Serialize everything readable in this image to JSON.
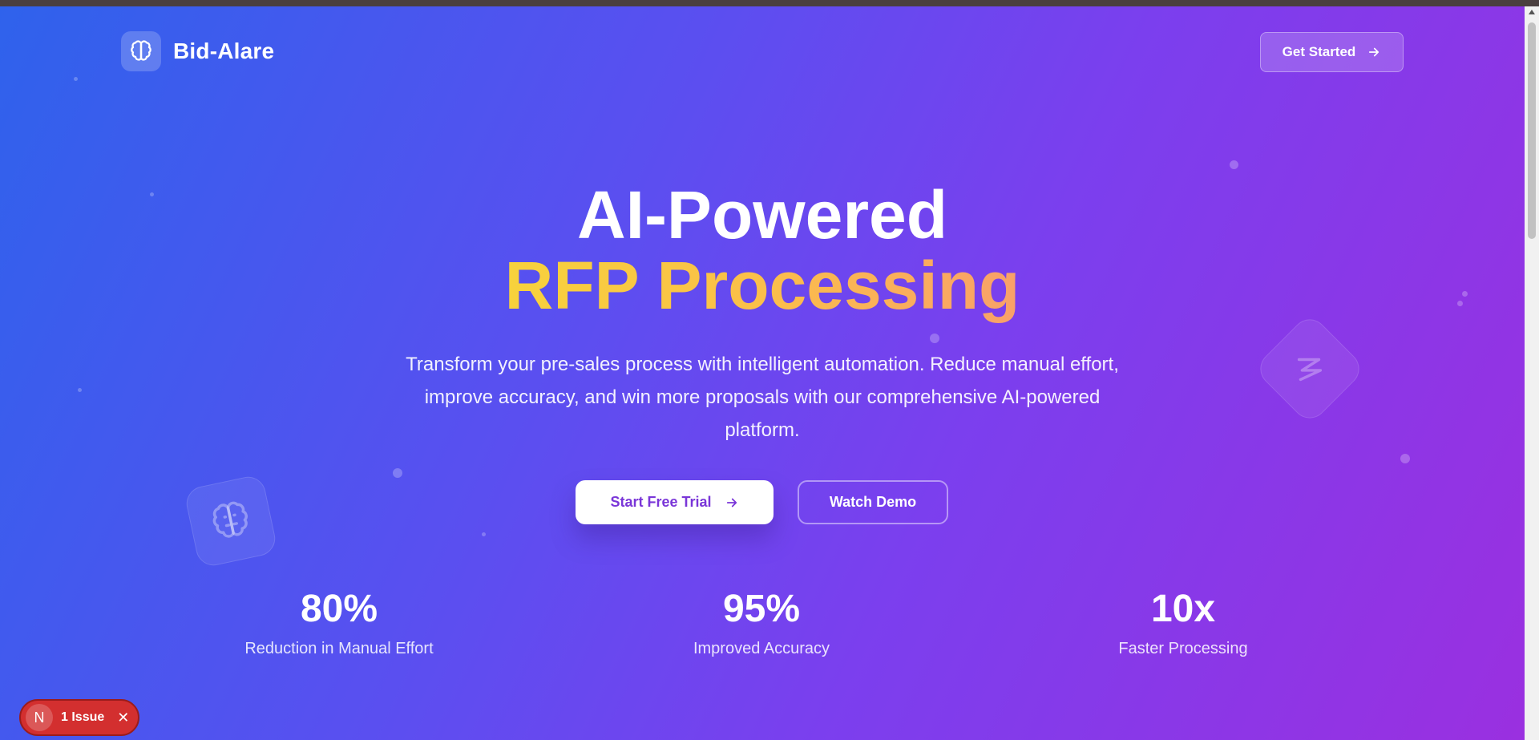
{
  "brand": {
    "name": "Bid-Alare",
    "logo_icon": "brain-icon"
  },
  "header": {
    "cta_label": "Get Started",
    "cta_icon": "arrow-right-icon"
  },
  "hero": {
    "title_line1": "AI-Powered",
    "title_line2": "RFP Processing",
    "subtitle": "Transform your pre-sales process with intelligent automation. Reduce manual effort, improve accuracy, and win more proposals with our comprehensive AI-powered platform.",
    "primary_button": "Start Free Trial",
    "secondary_button": "Watch Demo"
  },
  "stats": [
    {
      "value": "80%",
      "label": "Reduction in Manual Effort"
    },
    {
      "value": "95%",
      "label": "Improved Accuracy"
    },
    {
      "value": "10x",
      "label": "Faster Processing"
    }
  ],
  "dev_overlay": {
    "badge_letter": "N",
    "issue_text": "1 Issue"
  },
  "colors": {
    "gradient_start": "#2f62ec",
    "gradient_end": "#9a30e0",
    "accent_yellow": "#f7d23c",
    "accent_orange": "#f9a06a",
    "issue_red": "#d32f2f"
  }
}
